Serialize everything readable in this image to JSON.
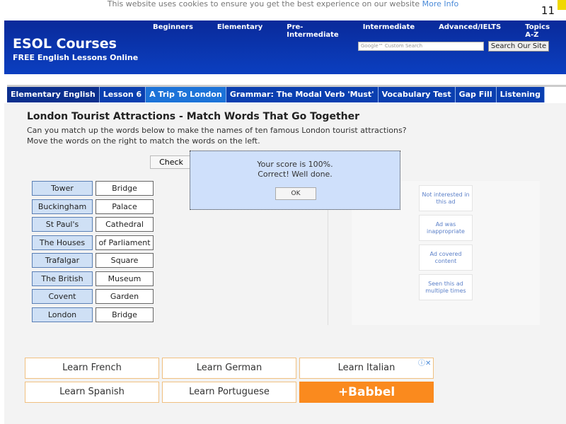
{
  "cookie": {
    "text": "This website uses cookies to ensure you get the best experience on our website",
    "link": "More Info"
  },
  "slide_number": "11",
  "header": {
    "title": "ESOL Courses",
    "subtitle": "FREE English Lessons Online",
    "nav": [
      "Beginners",
      "Elementary",
      "Pre-Intermediate",
      "Intermediate",
      "Advanced/IELTS",
      "Topics A-Z"
    ],
    "search_placeholder": "Google™ Custom Search",
    "search_button": "Search Our Site"
  },
  "breadcrumb": [
    "Elementary English",
    "Lesson 6",
    "A Trip To London",
    "Grammar: The Modal Verb 'Must'",
    "Vocabulary Test",
    "Gap Fill",
    "Listening"
  ],
  "main": {
    "title": "London Tourist Attractions - Match Words That Go Together",
    "intro1": "Can you match up the words below to make the names of ten famous London tourist attractions?",
    "intro2": "Move the words on the right to match the words on the left.",
    "check": "Check",
    "pairs": [
      [
        "Tower",
        "Bridge"
      ],
      [
        "Buckingham",
        "Palace"
      ],
      [
        "St Paul's",
        "Cathedral"
      ],
      [
        "The Houses",
        "of Parliament"
      ],
      [
        "Trafalgar",
        "Square"
      ],
      [
        "The British",
        "Museum"
      ],
      [
        "Covent",
        "Garden"
      ],
      [
        "London",
        "Bridge"
      ]
    ]
  },
  "dialog": {
    "line1": "Your score is 100%.",
    "line2": "Correct! Well done.",
    "ok": "OK"
  },
  "ad_feedback": [
    "Not interested in this ad",
    "Ad was inappropriate",
    "Ad covered content",
    "Seen this ad multiple times"
  ],
  "ads": [
    "Learn French",
    "Learn German",
    "Learn Italian",
    "Learn Spanish",
    "Learn Portuguese",
    "+Babbel"
  ]
}
